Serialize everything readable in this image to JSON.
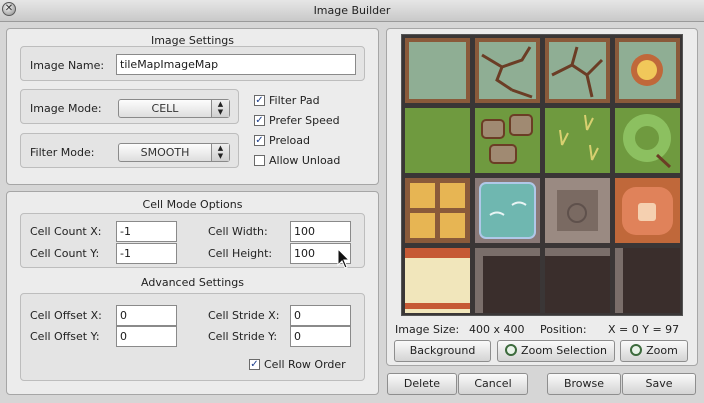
{
  "window": {
    "title": "Image Builder"
  },
  "image_settings": {
    "section_title": "Image Settings",
    "image_name_label": "Image Name:",
    "image_name_value": "tileMapImageMap",
    "image_mode_label": "Image Mode:",
    "image_mode_value": "CELL",
    "filter_mode_label": "Filter Mode:",
    "filter_mode_value": "SMOOTH",
    "checkboxes": [
      {
        "label": "Filter Pad",
        "checked": true
      },
      {
        "label": "Prefer Speed",
        "checked": true
      },
      {
        "label": "Preload",
        "checked": true
      },
      {
        "label": "Allow Unload",
        "checked": false
      }
    ]
  },
  "cell_mode": {
    "section_title": "Cell Mode Options",
    "cell_count_x_label": "Cell Count X:",
    "cell_count_x_value": "-1",
    "cell_count_y_label": "Cell Count Y:",
    "cell_count_y_value": "-1",
    "cell_width_label": "Cell Width:",
    "cell_width_value": "100",
    "cell_height_label": "Cell Height:",
    "cell_height_value": "100"
  },
  "advanced": {
    "section_title": "Advanced Settings",
    "cell_offset_x_label": "Cell Offset X:",
    "cell_offset_x_value": "0",
    "cell_offset_y_label": "Cell Offset Y:",
    "cell_offset_y_value": "0",
    "cell_stride_x_label": "Cell Stride X:",
    "cell_stride_x_value": "0",
    "cell_stride_y_label": "Cell Stride Y:",
    "cell_stride_y_value": "0",
    "cell_row_order_label": "Cell Row Order",
    "cell_row_order_checked": true
  },
  "preview": {
    "image_size_label": "Image Size:",
    "image_size_value": "400 x 400",
    "position_label": "Position:",
    "position_value": "X = 0 Y = 97",
    "background_button": "Background",
    "zoom_selection_button": "Zoom Selection",
    "zoom_button": "Zoom"
  },
  "actions": {
    "delete": "Delete",
    "cancel": "Cancel",
    "browse": "Browse",
    "save": "Save"
  },
  "colors": {
    "grass": "#6f9a3f",
    "stone": "#8fae94",
    "frame": "#8a5a3a",
    "dark": "#3a2e2c",
    "sand": "#f1e6bb",
    "accent": "#1e3f8c"
  }
}
